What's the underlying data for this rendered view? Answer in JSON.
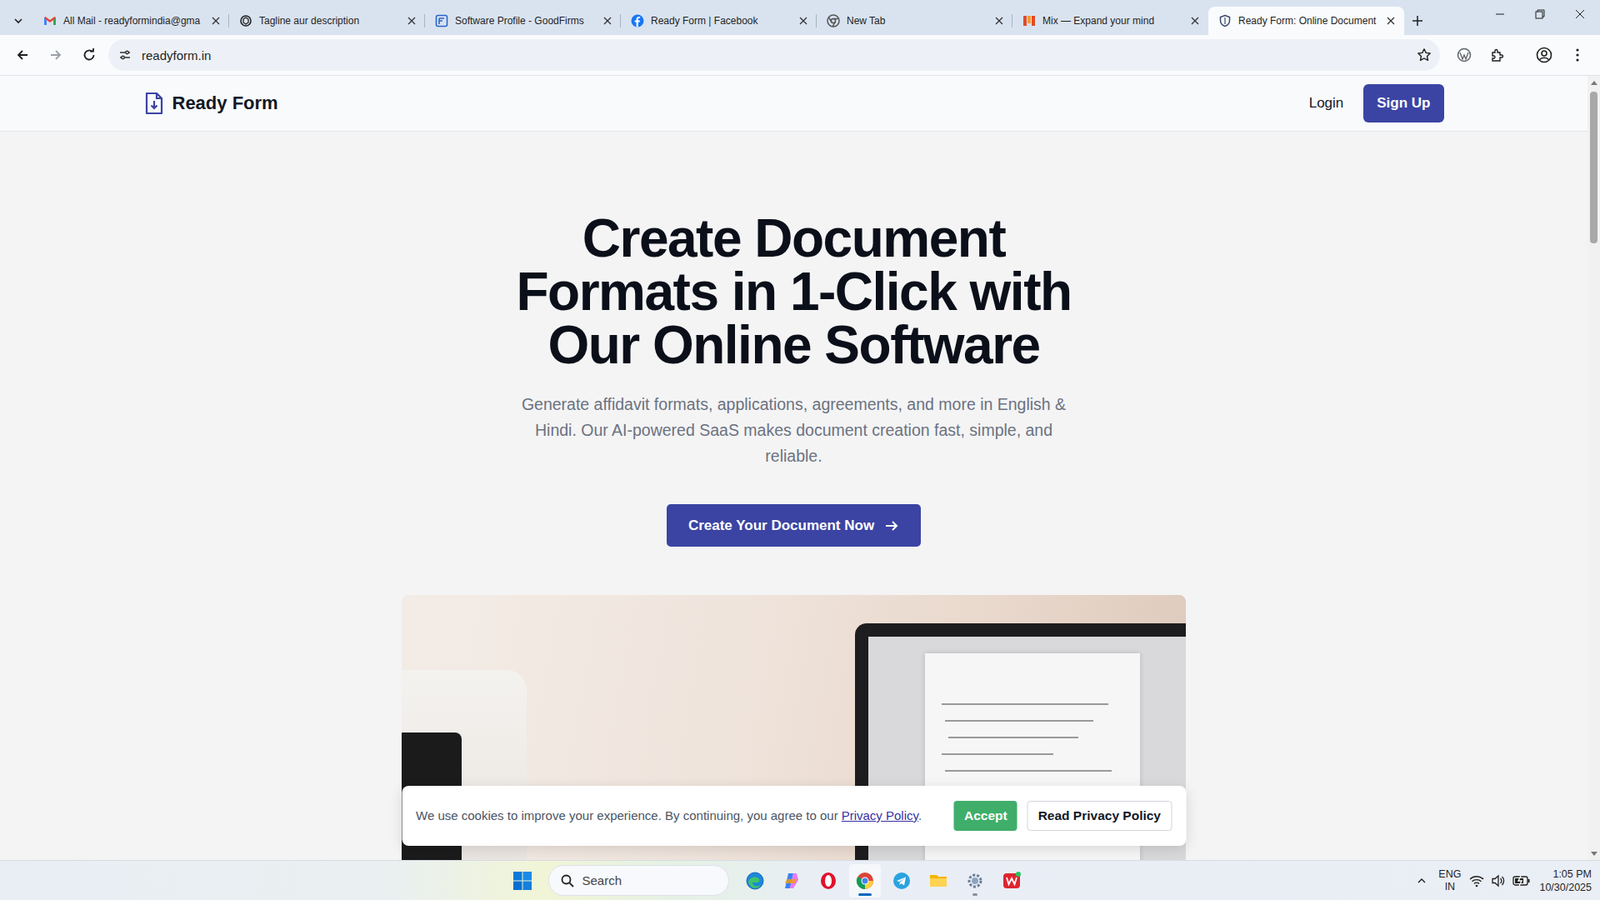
{
  "browser": {
    "tabs": [
      {
        "label": "All Mail - readyformindia@gma",
        "selected": false
      },
      {
        "label": "Tagline aur description",
        "selected": false
      },
      {
        "label": "Software Profile - GoodFirms",
        "selected": false
      },
      {
        "label": "Ready Form | Facebook",
        "selected": false
      },
      {
        "label": "New Tab",
        "selected": false
      },
      {
        "label": "Mix — Expand your mind",
        "selected": false
      },
      {
        "label": "Ready Form: Online Document",
        "selected": true
      }
    ],
    "address": "readyform.in"
  },
  "page": {
    "brand": "Ready Form",
    "nav": {
      "login": "Login",
      "signup": "Sign Up"
    },
    "hero": {
      "title_lines": [
        "Create Document",
        "Formats in 1-Click with",
        "Our Online Software"
      ],
      "subtitle_lines": [
        "Generate affidavit formats, applications, agreements, and more in English &",
        "Hindi. Our AI-powered SaaS makes document creation fast, simple, and",
        "reliable."
      ],
      "cta": "Create Your Document Now"
    },
    "cookie_banner": {
      "text": "We use cookies to improve your experience. By continuing, you agree to our",
      "link": "Privacy Policy",
      "end": ".",
      "accept": "Accept",
      "read": "Read Privacy Policy"
    },
    "scrollbar": {
      "level": 0.2
    }
  },
  "taskbar": {
    "search": "Search",
    "apps": [
      {
        "active": false,
        "running": false
      },
      {
        "active": false,
        "running": false
      },
      {
        "active": false,
        "running": false
      },
      {
        "active": true,
        "running": true
      },
      {
        "active": false,
        "running": false
      },
      {
        "active": false,
        "running": false
      },
      {
        "active": false,
        "running": true
      },
      {
        "active": false,
        "running": false
      }
    ],
    "language": "ENG",
    "region": "IN",
    "time": "1:05 PM",
    "date": "10/30/2025"
  }
}
